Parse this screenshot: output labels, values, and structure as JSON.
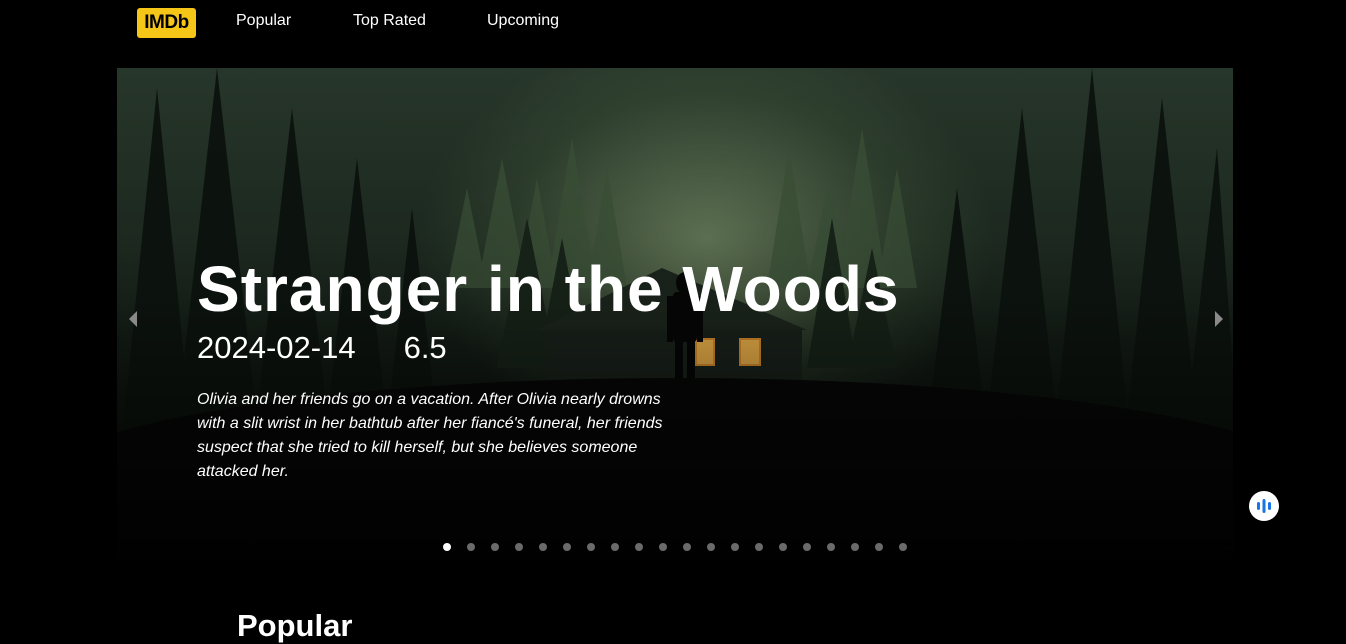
{
  "header": {
    "logo_text": "IMDb",
    "nav": [
      {
        "label": "Popular"
      },
      {
        "label": "Top Rated"
      },
      {
        "label": "Upcoming"
      }
    ]
  },
  "hero": {
    "title": "Stranger in the Woods",
    "release_date": "2024-02-14",
    "rating": "6.5",
    "description": "Olivia and her friends go on a vacation. After Olivia nearly drowns with a slit wrist in her bathtub after her fiancé's funeral, her friends suspect that she tried to kill herself, but she believes someone attacked her.",
    "prev_icon": "chevron-left-icon",
    "next_icon": "chevron-right-icon"
  },
  "carousel": {
    "slide_count": 20,
    "active_index": 0
  },
  "voice_button": {
    "icon": "voice-bars-icon",
    "accent": "#1a73e8"
  },
  "section": {
    "title": "Popular"
  },
  "colors": {
    "logo_bg": "#f5c518",
    "background": "#000000"
  }
}
